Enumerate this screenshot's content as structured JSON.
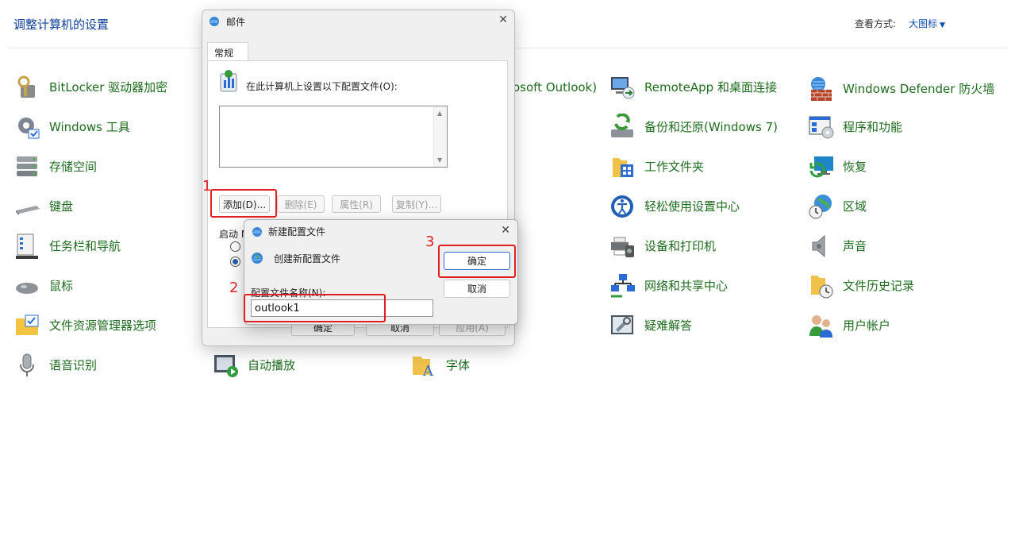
{
  "header": {
    "title": "调整计算机的设置",
    "view_label": "查看方式:",
    "view_value": "大图标"
  },
  "items": [
    {
      "label": "BitLocker 驱动器加密",
      "icon": "bitlocker-icon"
    },
    {
      "label": "Windows 工具",
      "icon": "windows-tools-icon"
    },
    {
      "label": "存储空间",
      "icon": "storage-spaces-icon"
    },
    {
      "label": "键盘",
      "icon": "keyboard-icon"
    },
    {
      "label": "任务栏和导航",
      "icon": "taskbar-icon"
    },
    {
      "label": "鼠标",
      "icon": "mouse-icon"
    },
    {
      "label": "文件资源管理器选项",
      "icon": "folder-options-icon"
    },
    {
      "label": "语音识别",
      "icon": "microphone-icon"
    },
    {
      "label": "自动播放",
      "icon": "autoplay-icon"
    },
    {
      "label": "字体",
      "icon": "fonts-icon"
    },
    {
      "label": "osoft Outlook)",
      "icon": ""
    },
    {
      "label": "RemoteApp 和桌面连接",
      "icon": "remoteapp-icon"
    },
    {
      "label": "备份和还原(Windows 7)",
      "icon": "backup-icon"
    },
    {
      "label": "工作文件夹",
      "icon": "work-folders-icon"
    },
    {
      "label": "轻松使用设置中心",
      "icon": "ease-of-access-icon"
    },
    {
      "label": "设备和打印机",
      "icon": "printer-icon"
    },
    {
      "label": "网络和共享中心",
      "icon": "network-icon"
    },
    {
      "label": "疑难解答",
      "icon": "troubleshoot-icon"
    },
    {
      "label": "Windows Defender 防火墙",
      "icon": "firewall-icon"
    },
    {
      "label": "程序和功能",
      "icon": "programs-icon"
    },
    {
      "label": "恢复",
      "icon": "recovery-icon"
    },
    {
      "label": "区域",
      "icon": "region-icon"
    },
    {
      "label": "声音",
      "icon": "speaker-icon"
    },
    {
      "label": "文件历史记录",
      "icon": "file-history-icon"
    },
    {
      "label": "用户帐户",
      "icon": "user-accounts-icon"
    }
  ],
  "mail_dialog": {
    "title": "邮件",
    "tab": "常规",
    "description": "在此计算机上设置以下配置文件(O):",
    "buttons": {
      "add": "添加(D)...",
      "remove": "删除(E)",
      "properties": "属性(R)",
      "copy": "复制(Y)..."
    },
    "startup_label": "启动 M",
    "footer": {
      "ok": "确定",
      "cancel": "取消",
      "apply": "应用(A)"
    }
  },
  "new_profile_dialog": {
    "title": "新建配置文件",
    "description": "创建新配置文件",
    "name_label": "配置文件名称(N):",
    "name_value": "outlook1",
    "ok": "确定",
    "cancel": "取消"
  },
  "annotations": {
    "step1": "1",
    "step2": "2",
    "step3": "3"
  },
  "colors": {
    "link_green": "#1e6d1e",
    "title_blue": "#0b3f99",
    "annotation_red": "#e02020"
  }
}
